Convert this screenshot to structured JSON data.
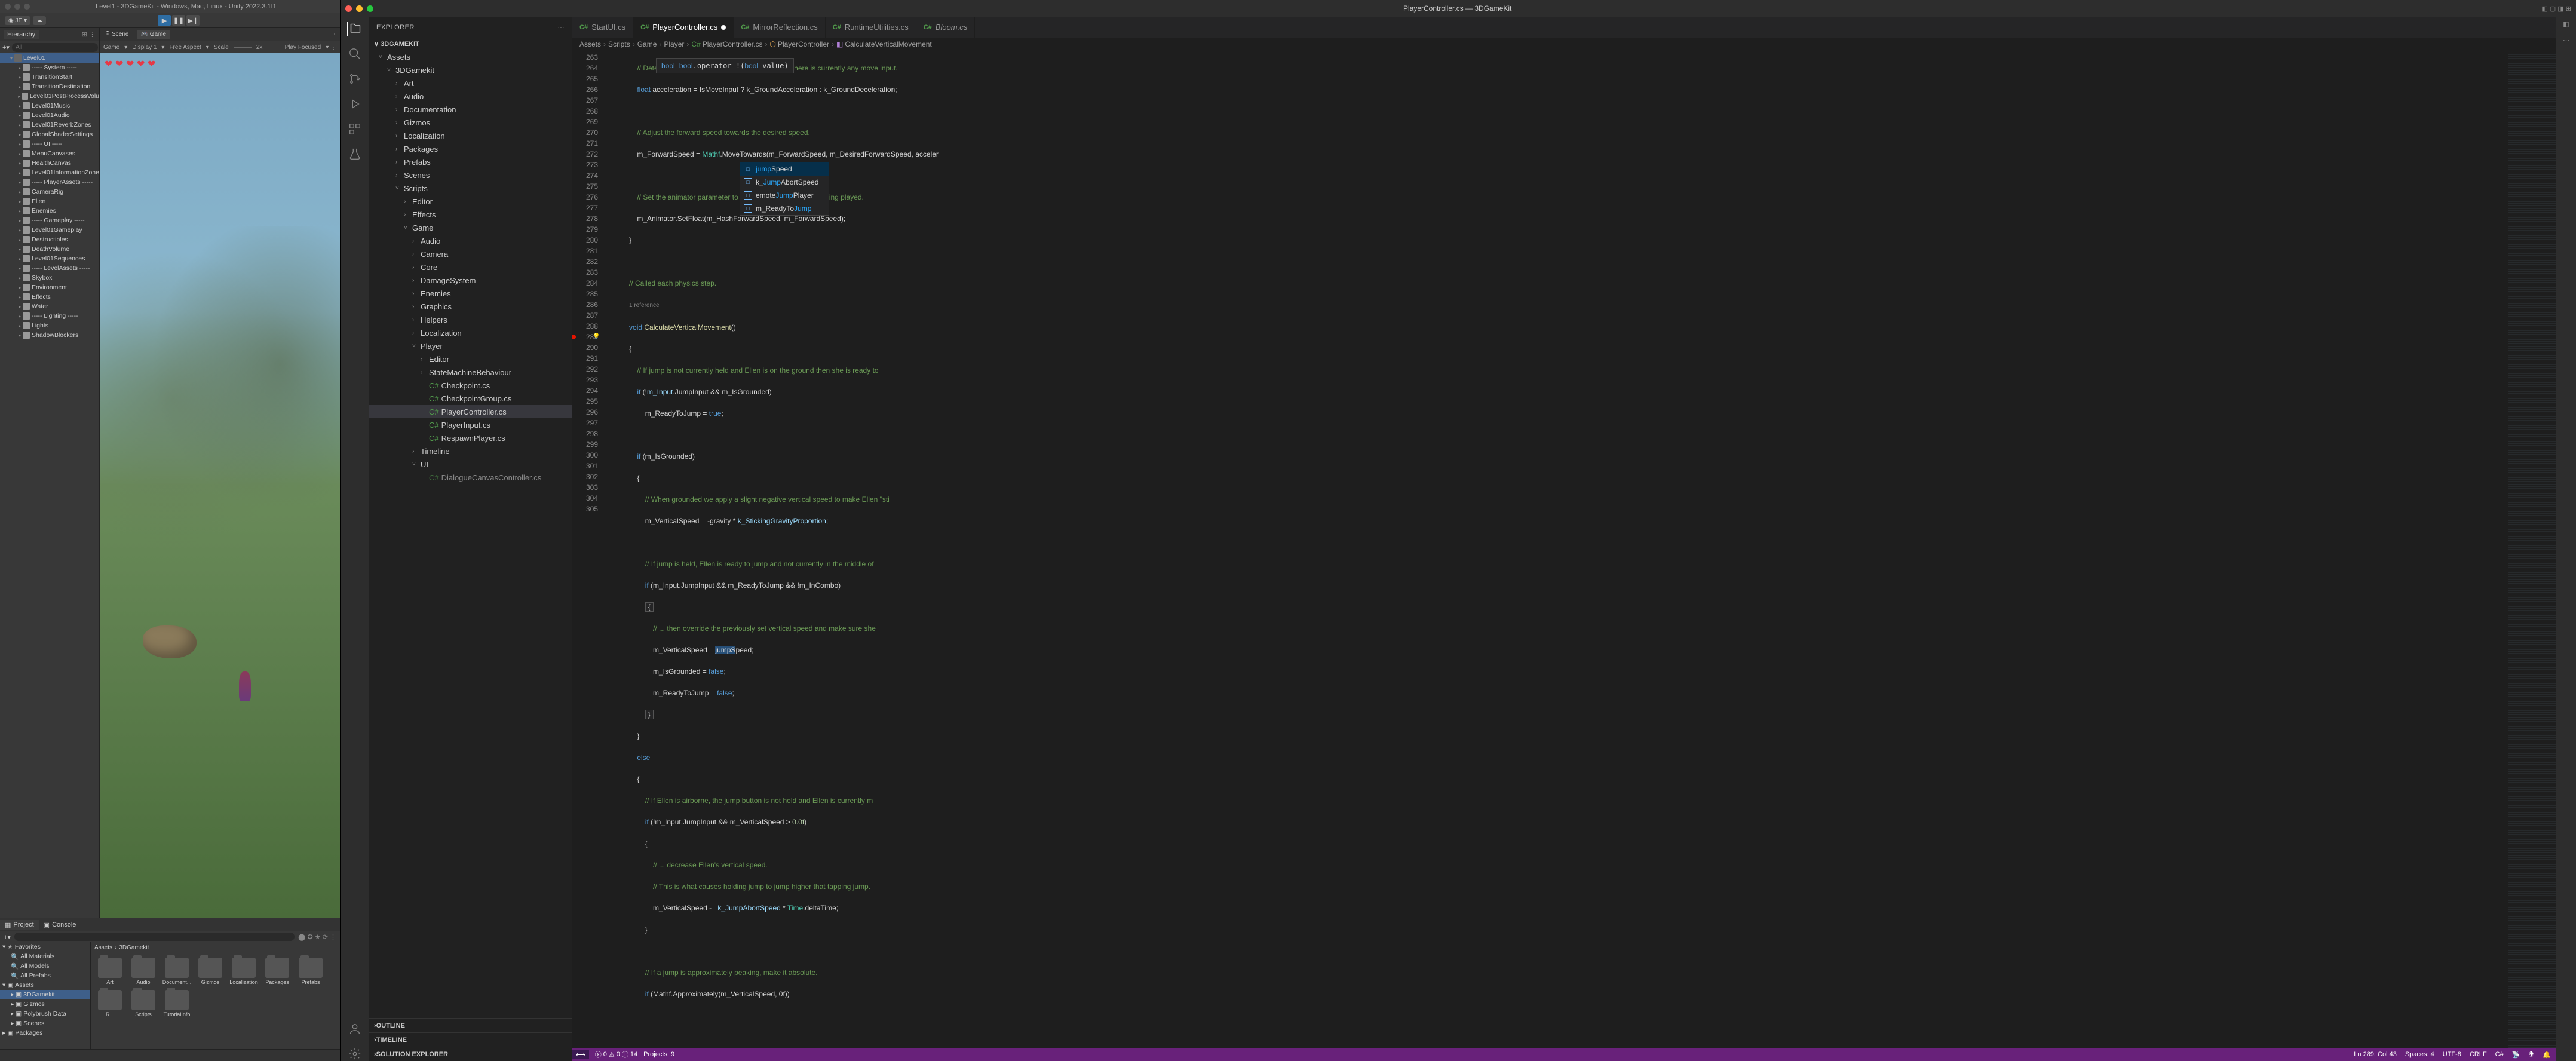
{
  "unity": {
    "title": "Level1 - 3DGameKit - Windows, Mac, Linux - Unity 2022.3.1f1",
    "account": "JE",
    "hierarchy_label": "Hierarchy",
    "search_placeholder": "All",
    "scene_root": "Level01",
    "hierarchy": [
      "----- System -----",
      "TransitionStart",
      "TransitionDestination",
      "Level01PostProcessVolu",
      "Level01Music",
      "Level01Audio",
      "Level01ReverbZones",
      "GlobalShaderSettings",
      "----- UI -----",
      "MenuCanvases",
      "HealthCanvas",
      "Level01InformationZone",
      "----- PlayerAssets -----",
      "CameraRig",
      "Ellen",
      "Enemies",
      "----- Gameplay -----",
      "Level01Gameplay",
      "Destructibles",
      "DeathVolume",
      "Level01Sequences",
      "----- LevelAssets -----",
      "Skybox",
      "Environment",
      "Effects",
      "Water",
      "----- Lighting -----",
      "Lights",
      "ShadowBlockers"
    ],
    "game_tabs": {
      "scene": "Scene",
      "game": "Game"
    },
    "game_controls": {
      "dropdown": "Game",
      "display": "Display 1",
      "aspect": "Free Aspect",
      "scale_label": "Scale",
      "scale_value": "2x",
      "play": "Play Focused"
    },
    "project_tab": "Project",
    "console_tab": "Console",
    "favorites": "Favorites",
    "fav_items": [
      "All Materials",
      "All Models",
      "All Prefabs"
    ],
    "assets_label": "Assets",
    "asset_tree": [
      "3DGamekit",
      "Gizmos",
      "Polybrush Data",
      "Scenes"
    ],
    "packages_label": "Packages",
    "breadcrumb": [
      "Assets",
      "3DGamekit"
    ],
    "folders_row1": [
      "Art",
      "Audio",
      "Document...",
      "Gizmos",
      "Localization",
      "Packages",
      "Prefabs",
      "R..."
    ],
    "folders_row2": [
      "Scripts",
      "TutorialInfo"
    ]
  },
  "vscode": {
    "title": "PlayerController.cs — 3DGameKit",
    "explorer": "EXPLORER",
    "workspace": "3DGAMEKIT",
    "tree": {
      "assets": "Assets",
      "threeDGamekit": "3DGamekit",
      "art": "Art",
      "audio": "Audio",
      "documentation": "Documentation",
      "gizmos": "Gizmos",
      "localization": "Localization",
      "packages": "Packages",
      "prefabs": "Prefabs",
      "scenes": "Scenes",
      "scripts": "Scripts",
      "editor": "Editor",
      "effects": "Effects",
      "game": "Game",
      "audio2": "Audio",
      "camera": "Camera",
      "core": "Core",
      "damageSystem": "DamageSystem",
      "enemies": "Enemies",
      "graphics": "Graphics",
      "helpers": "Helpers",
      "localization2": "Localization",
      "player": "Player",
      "editor2": "Editor",
      "smb": "StateMachineBehaviour",
      "checkpoint": "Checkpoint.cs",
      "checkpointGroup": "CheckpointGroup.cs",
      "playerController": "PlayerController.cs",
      "playerInput": "PlayerInput.cs",
      "respawnPlayer": "RespawnPlayer.cs",
      "timeline": "Timeline",
      "ui": "UI",
      "dialogueCanvas": "DialogueCanvasController.cs"
    },
    "sections": {
      "outline": "OUTLINE",
      "timeline": "TIMELINE",
      "solution": "SOLUTION EXPLORER"
    },
    "tabs": [
      {
        "name": "StartUI.cs",
        "active": false,
        "modified": false
      },
      {
        "name": "PlayerController.cs",
        "active": true,
        "modified": true
      },
      {
        "name": "MirrorReflection.cs",
        "active": false,
        "modified": false
      },
      {
        "name": "RuntimeUtilities.cs",
        "active": false,
        "modified": false
      },
      {
        "name": "Bloom.cs",
        "active": false,
        "modified": false,
        "italic": true
      }
    ],
    "breadcrumb": [
      "Assets",
      "Scripts",
      "Game",
      "Player",
      "PlayerController.cs",
      "PlayerController",
      "CalculateVerticalMovement"
    ],
    "line_start": 263,
    "line_end": 305,
    "breakpoint_line": 289,
    "hover_tooltip": "bool bool.operator !(bool value)",
    "autocomplete": [
      {
        "text": "jumpSpeed",
        "match": "jump"
      },
      {
        "text": "k_JumpAbortSpeed",
        "match": "Jump"
      },
      {
        "text": "emoteJumpPlayer",
        "match": "Jump"
      },
      {
        "text": "m_ReadyToJump",
        "match": "Jump"
      }
    ],
    "code": {
      "l263": "// Determine change to speed based on whether there is currently any move input.",
      "l264a": "float",
      "l264b": " acceleration = IsMoveInput ? k_GroundAcceleration : k_GroundDeceleration;",
      "l266": "// Adjust the forward speed towards the desired speed.",
      "l267a": "m_ForwardSpeed = ",
      "l267b": "Mathf",
      "l267c": ".MoveTowards(m_ForwardSpeed, m_DesiredForwardSpeed, acceler",
      "l269": "// Set the animator parameter to control what animation is being played.",
      "l270": "m_Animator.SetFloat(m_HashForwardSpeed, m_ForwardSpeed);",
      "l273": "// Called each physics step.",
      "l273r": "1 reference",
      "l274a": "void",
      "l274b": " CalculateVerticalMovement",
      "l274c": "()",
      "l276": "// If jump is not currently held and Ellen is on the ground then she is ready to",
      "l277a": "if",
      "l277b": " (!",
      "l277c": "m_Input",
      "l277d": ".JumpInput && m_IsGrounded)",
      "l278a": "m_ReadyToJump = ",
      "l278b": "true",
      "l278c": ";",
      "l280a": "if",
      "l280b": " (m_IsGrounded)",
      "l282": "// When grounded we apply a slight negative vertical speed to make Ellen \"sti",
      "l283a": "m_VerticalSpeed = -gravity * ",
      "l283b": "k_StickingGravityProportion",
      "l283c": ";",
      "l285": "// If jump is held, Ellen is ready to jump and not currently in the middle of",
      "l286a": "if",
      "l286b": " (m_Input.JumpInput && m_ReadyToJump && !m_InCombo)",
      "l288": "// ... then override the previously set vertical speed and make sure she",
      "l289a": "m_VerticalSpeed = ",
      "l289b": "jumpS",
      "l289c": "peed;",
      "l290a": "m_IsGrounded = ",
      "l290b": "false",
      "l290c": ";",
      "l291a": "m_ReadyToJump = ",
      "l291b": "false",
      "l291c": ";",
      "l294": "else",
      "l296": "// If Ellen is airborne, the jump button is not held and Ellen is currently m",
      "l297a": "if",
      "l297b": " (!m_Input.JumpInput && m_VerticalSpeed > ",
      "l297c": "0.0f",
      "l297d": ")",
      "l299": "// ... decrease Ellen's vertical speed.",
      "l300": "// This is what causes holding jump to jump higher that tapping jump.",
      "l301a": "m_VerticalSpeed -= ",
      "l301b": "k_JumpAbortSpeed",
      "l301c": " * ",
      "l301d": "Time",
      "l301e": ".deltaTime;",
      "l304": "// If a jump is approximately peaking, make it absolute.",
      "l305a": "if",
      "l305b": " (Mathf.Approximately(m_VerticalSpeed, 0f))"
    },
    "status": {
      "errors": "0",
      "warnings": "0",
      "info": "14",
      "projects": "Projects: 9",
      "cursor": "Ln 289, Col 43",
      "spaces": "Spaces: 4",
      "encoding": "UTF-8",
      "eol": "CRLF",
      "lang": "C#"
    }
  }
}
